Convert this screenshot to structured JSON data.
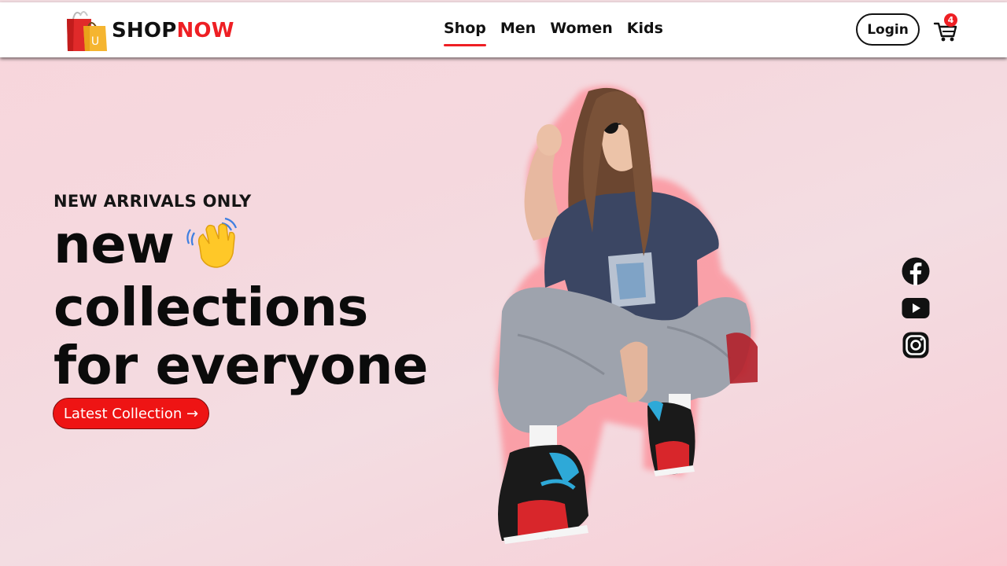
{
  "brand": {
    "part1": "SHOP",
    "part2": "NOW",
    "bag_letter": "U"
  },
  "nav": {
    "items": [
      {
        "label": "Shop",
        "active": true
      },
      {
        "label": "Men",
        "active": false
      },
      {
        "label": "Women",
        "active": false
      },
      {
        "label": "Kids",
        "active": false
      }
    ],
    "login_label": "Login",
    "cart_count": "4"
  },
  "hero": {
    "eyebrow": "NEW ARRIVALS ONLY",
    "headline_lines": [
      "new",
      "collections",
      "for everyone"
    ],
    "cta_label": "Latest Collection →",
    "image_name": "model-image"
  },
  "socials": [
    {
      "name": "facebook-icon"
    },
    {
      "name": "youtube-icon"
    },
    {
      "name": "instagram-icon"
    }
  ],
  "colors": {
    "accent": "#ee1f24",
    "cta": "#ee1414",
    "text": "#111111",
    "bg": "#f5d8de"
  }
}
